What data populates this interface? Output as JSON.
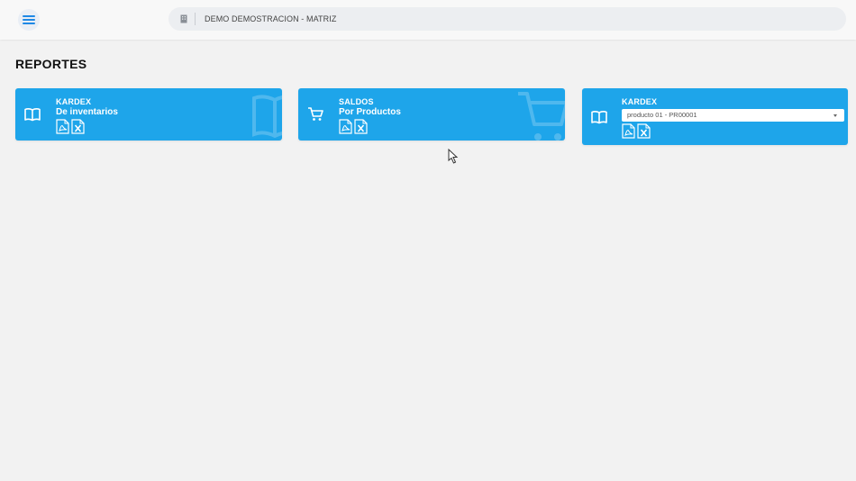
{
  "header": {
    "company_name": "DEMO DEMOSTRACION - MATRIZ",
    "menu_icon": "hamburger-menu-icon",
    "company_icon": "building-icon"
  },
  "page": {
    "title": "REPORTES"
  },
  "cards": [
    {
      "title": "KARDEX",
      "subtitle": "De inventarios",
      "icon": "book-icon",
      "watermark": "book-icon",
      "exports": [
        "pdf-file-icon",
        "excel-file-icon"
      ]
    },
    {
      "title": "SALDOS",
      "subtitle": "Por Productos",
      "icon": "shopping-cart-icon",
      "watermark": "shopping-cart-icon",
      "exports": [
        "pdf-file-icon",
        "excel-file-icon"
      ]
    },
    {
      "title": "KARDEX",
      "icon": "book-icon",
      "select": {
        "value": "producto 01 - PR00001"
      },
      "exports": [
        "pdf-file-icon",
        "excel-file-icon"
      ]
    }
  ],
  "colors": {
    "card_bg": "#1ea5ea",
    "page_bg": "#f2f2f2",
    "menu_icon": "#1e88e5"
  }
}
